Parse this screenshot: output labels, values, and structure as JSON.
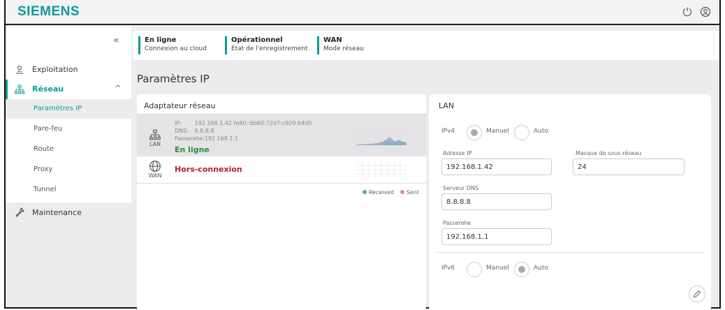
{
  "brand": "SIEMENS",
  "colors": {
    "accent": "#0d9a9b",
    "ok": "#2b8a3e",
    "error": "#b3202a",
    "received": "#5ba3b8",
    "sent": "#d98aa0"
  },
  "topbar": {
    "icons": [
      "power-icon",
      "user-icon"
    ]
  },
  "sidebar": {
    "collapse_glyph": "«",
    "items": [
      {
        "label": "Exploitation",
        "icon": "operation-icon"
      },
      {
        "label": "Réseau",
        "icon": "network-icon",
        "expanded": true,
        "children": [
          "Paramètres IP",
          "Pare-feu",
          "Route",
          "Proxy",
          "Tunnel"
        ]
      },
      {
        "label": "Maintenance",
        "icon": "wrench-icon"
      }
    ],
    "chevron": "^"
  },
  "status": [
    {
      "title": "En ligne",
      "sub": "Connexion au cloud"
    },
    {
      "title": "Opérationnel",
      "sub": "Etat de l'enregistrement"
    },
    {
      "title": "WAN",
      "sub": "Mode réseau"
    }
  ],
  "page_title": "Paramètres IP",
  "adapters": {
    "header": "Adaptateur réseau",
    "lan": {
      "name": "LAN",
      "ip_label": "IP:",
      "ip_value": "192.168.1.42 fe80::6b60:72d7:c929:b4d5",
      "dns_label": "DNS:",
      "dns_value": "8.8.8.8",
      "gw_text": "Passerelle:192.168.1.1",
      "status": "En ligne"
    },
    "wan": {
      "name": "WAN",
      "status": "Hors-connexion"
    },
    "legend": {
      "received": "Received",
      "sent": "Sent"
    }
  },
  "lan": {
    "header": "LAN",
    "ipv4": {
      "label": "IPv4",
      "manual": "Manuel",
      "auto": "Auto",
      "selected": "manual"
    },
    "ip_address": {
      "label": "Adresse IP",
      "value": "192.168.1.42"
    },
    "subnet": {
      "label": "Masque de sous-réseau",
      "value": "24"
    },
    "dns": {
      "label": "Serveur DNS",
      "value": "8.8.8.8"
    },
    "gateway": {
      "label": "Passerelle",
      "value": "192.168.1.1"
    },
    "ipv6": {
      "label": "IPv6",
      "manual": "Manuel",
      "auto": "Auto",
      "selected": "auto"
    }
  }
}
